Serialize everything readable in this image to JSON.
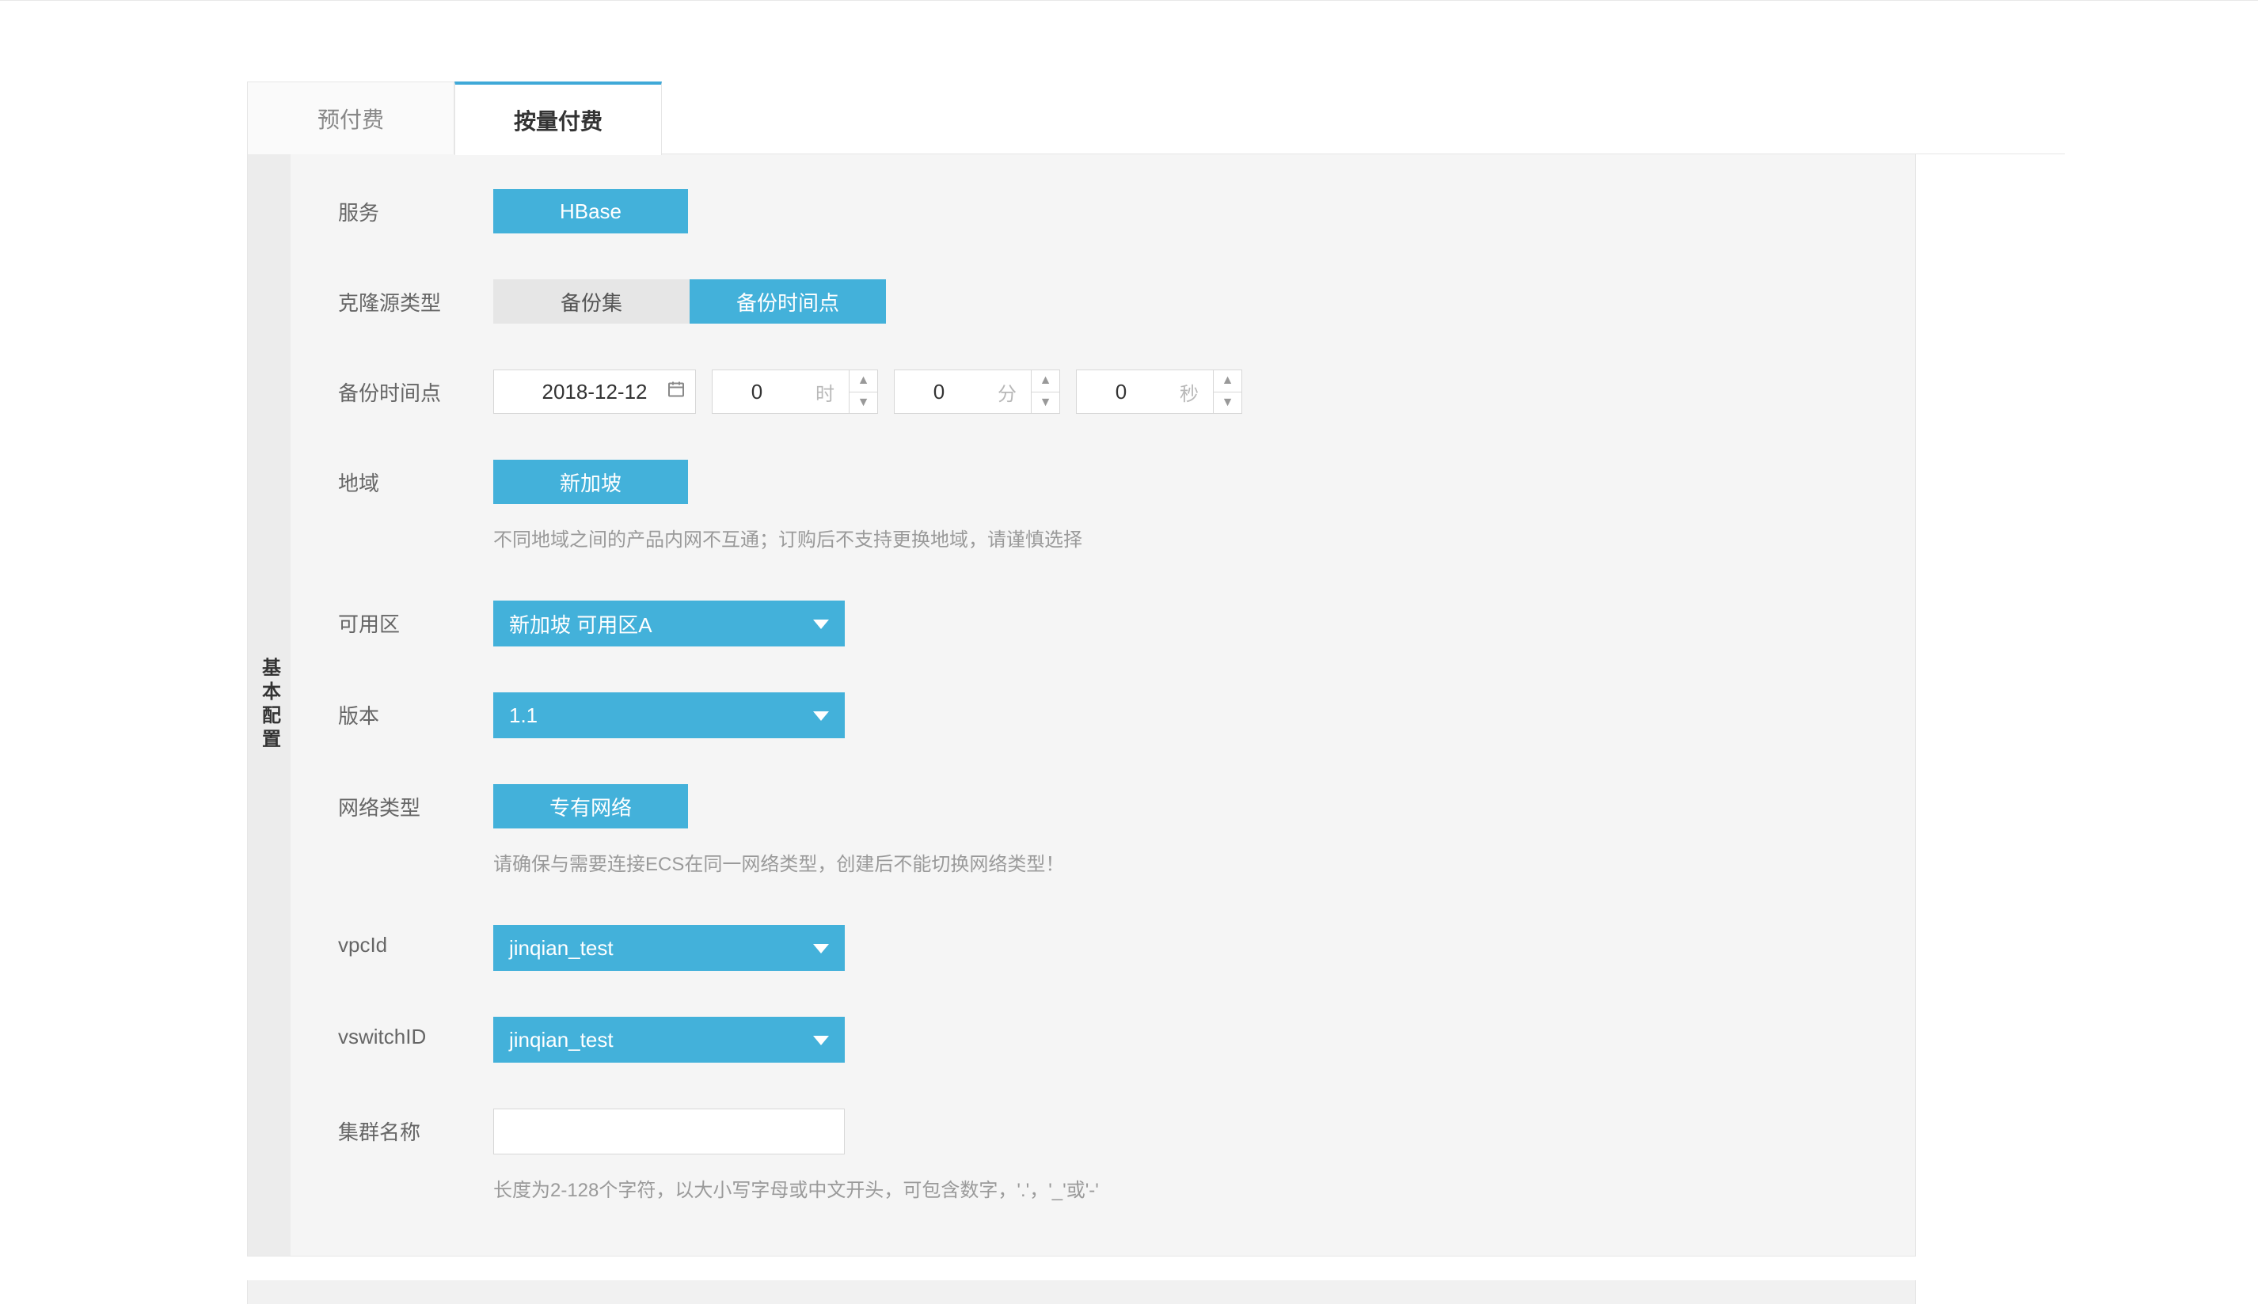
{
  "tabs": {
    "prepaid": "预付费",
    "postpaid": "按量付费"
  },
  "sidebar_label": "基本配置",
  "service": {
    "label": "服务",
    "value": "HBase"
  },
  "clone_source": {
    "label": "克隆源类型",
    "option_backupset": "备份集",
    "option_backuptime": "备份时间点"
  },
  "backup_time": {
    "label": "备份时间点",
    "date": "2018-12-12",
    "hour_value": "0",
    "hour_unit": "时",
    "minute_value": "0",
    "minute_unit": "分",
    "second_value": "0",
    "second_unit": "秒"
  },
  "region": {
    "label": "地域",
    "value": "新加坡",
    "hint": "不同地域之间的产品内网不互通；订购后不支持更换地域，请谨慎选择"
  },
  "zone": {
    "label": "可用区",
    "value": "新加坡 可用区A"
  },
  "version": {
    "label": "版本",
    "value": "1.1"
  },
  "network_type": {
    "label": "网络类型",
    "value": "专有网络",
    "hint": "请确保与需要连接ECS在同一网络类型，创建后不能切换网络类型！"
  },
  "vpc": {
    "label": "vpcId",
    "value": "jinqian_test"
  },
  "vswitch": {
    "label": "vswitchID",
    "value": "jinqian_test"
  },
  "cluster_name": {
    "label": "集群名称",
    "value": "",
    "hint": "长度为2-128个字符，以大小写字母或中文开头，可包含数字，'.'，'_'或'-'"
  }
}
